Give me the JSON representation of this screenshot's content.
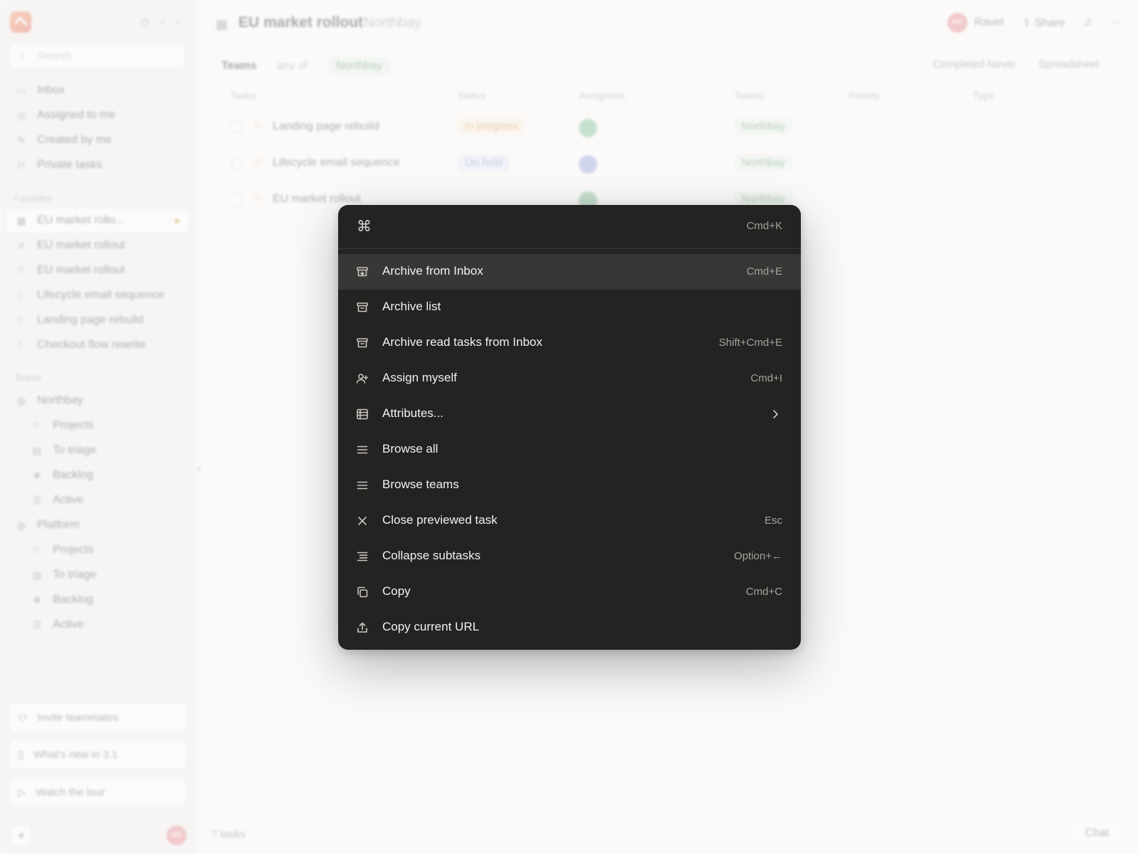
{
  "sidebar": {
    "search_placeholder": "Search",
    "nav": [
      {
        "label": "Inbox"
      },
      {
        "label": "Assigned to me"
      },
      {
        "label": "Created by me"
      },
      {
        "label": "Private tasks"
      }
    ],
    "favorites_heading": "Favorites",
    "favorites": [
      {
        "label": "EU market rollo..."
      },
      {
        "label": "EU market rollout"
      },
      {
        "label": "EU market rollout"
      },
      {
        "label": "Lifecycle email sequence"
      },
      {
        "label": "Landing page rebuild"
      },
      {
        "label": "Checkout flow rewrite"
      }
    ],
    "teams_heading": "Teams",
    "teams": [
      {
        "label": "Northbay",
        "children": [
          "Projects",
          "To triage",
          "Backlog",
          "Active"
        ]
      },
      {
        "label": "Platform",
        "children": [
          "Projects",
          "To triage",
          "Backlog",
          "Active"
        ]
      }
    ],
    "cards": [
      "Invite teammates",
      "What's new in 3.1",
      "Watch the tour"
    ],
    "avatar_initials": "MR"
  },
  "header": {
    "title": "EU market rollout",
    "subtitle": "Northbay",
    "user_name": "Ravel",
    "avatar_initials": "MR",
    "share_label": "Share"
  },
  "filter": {
    "field": "Teams",
    "operator": "any of",
    "value": "Northbay",
    "completed": "Completed Never",
    "view": "Spreadsheet"
  },
  "table": {
    "columns": [
      "Tasks",
      "Status",
      "Assignees",
      "Teams",
      "Priority",
      "Type"
    ],
    "rows": [
      {
        "name": "Landing page rebuild",
        "status": "In progress",
        "team": "Northbay"
      },
      {
        "name": "Lifecycle email sequence",
        "status": "On hold",
        "team": "Northbay"
      },
      {
        "name": "EU market rollout",
        "status": "",
        "team": "Northbay"
      }
    ],
    "footer_count": "7 tasks",
    "chat_label": "Chat"
  },
  "palette": {
    "input_value": "",
    "shortcut_hint": "Cmd+K",
    "items": [
      {
        "label": "Archive from Inbox",
        "shortcut": "Cmd+E",
        "icon": "archive-icon",
        "selected": true
      },
      {
        "label": "Archive list",
        "shortcut": "",
        "icon": "archive-icon"
      },
      {
        "label": "Archive read tasks from Inbox",
        "shortcut": "Shift+Cmd+E",
        "icon": "archive-icon"
      },
      {
        "label": "Assign myself",
        "shortcut": "Cmd+I",
        "icon": "user-plus-icon"
      },
      {
        "label": "Attributes...",
        "shortcut": "",
        "icon": "table-icon",
        "submenu": true
      },
      {
        "label": "Browse all",
        "shortcut": "",
        "icon": "list-icon"
      },
      {
        "label": "Browse teams",
        "shortcut": "",
        "icon": "list-icon"
      },
      {
        "label": "Close previewed task",
        "shortcut": "Esc",
        "icon": "close-icon"
      },
      {
        "label": "Collapse subtasks",
        "shortcut": "Option+←",
        "icon": "indent-list-icon"
      },
      {
        "label": "Copy",
        "shortcut": "Cmd+C",
        "icon": "copy-icon"
      },
      {
        "label": "Copy current URL",
        "shortcut": "",
        "icon": "share-icon"
      }
    ]
  }
}
